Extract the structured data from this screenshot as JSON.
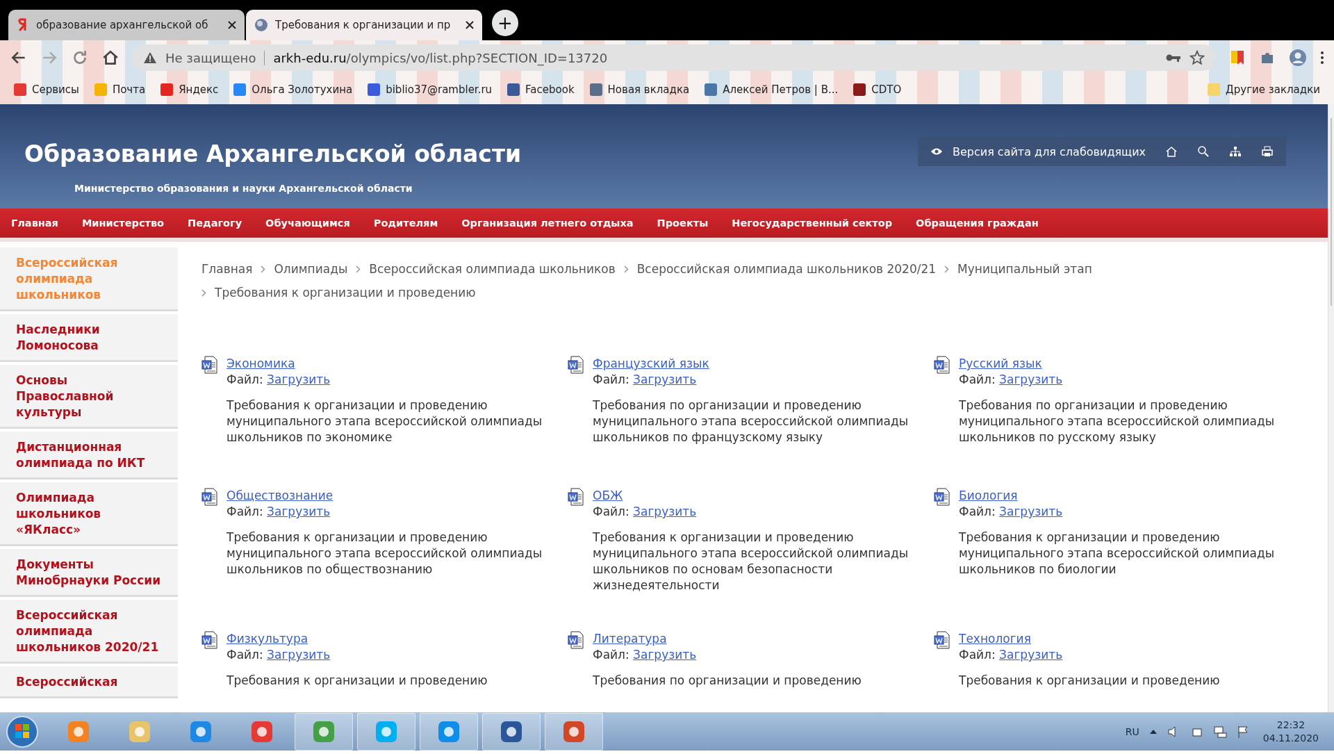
{
  "browser": {
    "tabs": [
      {
        "title": "образование архангельской об",
        "selected": false
      },
      {
        "title": "Требования к организации и пр",
        "selected": true
      }
    ],
    "new_tab": "+",
    "address": {
      "security": "Не защищено",
      "host": "arkh-edu.ru",
      "path": "/olympics/vo/list.php?SECTION_ID=13720"
    },
    "bookmarks": [
      {
        "label": "Сервисы"
      },
      {
        "label": "Почта"
      },
      {
        "label": "Яндекс"
      },
      {
        "label": "Ольга Золотухина"
      },
      {
        "label": "biblio37@rambler.ru"
      },
      {
        "label": "Facebook"
      },
      {
        "label": "Новая вкладка"
      },
      {
        "label": "Алексей Петров | В..."
      },
      {
        "label": "CDTO"
      }
    ],
    "other_bookmarks": "Другие закладки"
  },
  "site": {
    "title": "Образование Архангельской области",
    "subtitle": "Министерство образования и науки Архангельской области",
    "accessibility_link": "Версия сайта для слабовидящих",
    "nav": [
      "Главная",
      "Министерство",
      "Педагогу",
      "Обучающимся",
      "Родителям",
      "Организация летнего отдыха",
      "Проекты",
      "Негосударственный сектор",
      "Обращения граждан"
    ],
    "sidebar": [
      {
        "label": "Всероссийская олимпиада школьников",
        "selected": true
      },
      {
        "label": "Наследники Ломоносова",
        "selected": false
      },
      {
        "label": "Основы Православной культуры",
        "selected": false
      },
      {
        "label": "Дистанционная олимпиада по ИКТ",
        "selected": false
      },
      {
        "label": "Олимпиада школьников «ЯКласс»",
        "selected": false
      },
      {
        "label": "Документы Минобрнауки России",
        "selected": false
      },
      {
        "label": "Всероссийская олимпиада школьников 2020/21",
        "selected": false
      },
      {
        "label": "Всероссийская",
        "selected": false
      }
    ],
    "breadcrumb": [
      "Главная",
      "Олимпиады",
      "Всероссийская олимпиада школьников",
      "Всероссийская олимпиада школьников 2020/21",
      "Муниципальный этап",
      "Требования к организации и проведению"
    ],
    "documents": [
      {
        "title": "Экономика",
        "file_label": "Файл:",
        "file_link": "Загрузить",
        "description": "Требования к организации и проведению муниципального этапа всероссийской олимпиады школьников по экономике"
      },
      {
        "title": "Французский язык",
        "file_label": "Файл:",
        "file_link": "Загрузить",
        "description": "Требования по организации и проведению муниципального этапа всероссийской олимпиады школьников по французскому языку"
      },
      {
        "title": "Русский язык",
        "file_label": "Файл:",
        "file_link": "Загрузить",
        "description": "Требования по организации и проведению муниципального этапа всероссийской олимпиады школьников по русскому языку"
      },
      {
        "title": "Обществознание",
        "file_label": "Файл:",
        "file_link": "Загрузить",
        "description": "Требования к организации и проведению муниципального этапа всероссийской олимпиады школьников по обществознанию"
      },
      {
        "title": "ОБЖ",
        "file_label": "Файл:",
        "file_link": "Загрузить",
        "description": "Требования к организации и проведению муниципального этапа всероссийской олимпиады школьников по основам безопасности жизнедеятельности"
      },
      {
        "title": "Биология",
        "file_label": "Файл:",
        "file_link": "Загрузить",
        "description": "Требования к организации и проведению муниципального этапа всероссийской олимпиады школьников по биологии"
      },
      {
        "title": "Физкультура",
        "file_label": "Файл:",
        "file_link": "Загрузить",
        "description": "Требования к организации и проведению"
      },
      {
        "title": "Литература",
        "file_label": "Файл:",
        "file_link": "Загрузить",
        "description": "Требования по организации и проведению"
      },
      {
        "title": "Технология",
        "file_label": "Файл:",
        "file_link": "Загрузить",
        "description": "Требования к организации и проведению"
      }
    ]
  },
  "taskbar": {
    "language": "RU",
    "time": "22:32",
    "date": "04.11.2020"
  }
}
